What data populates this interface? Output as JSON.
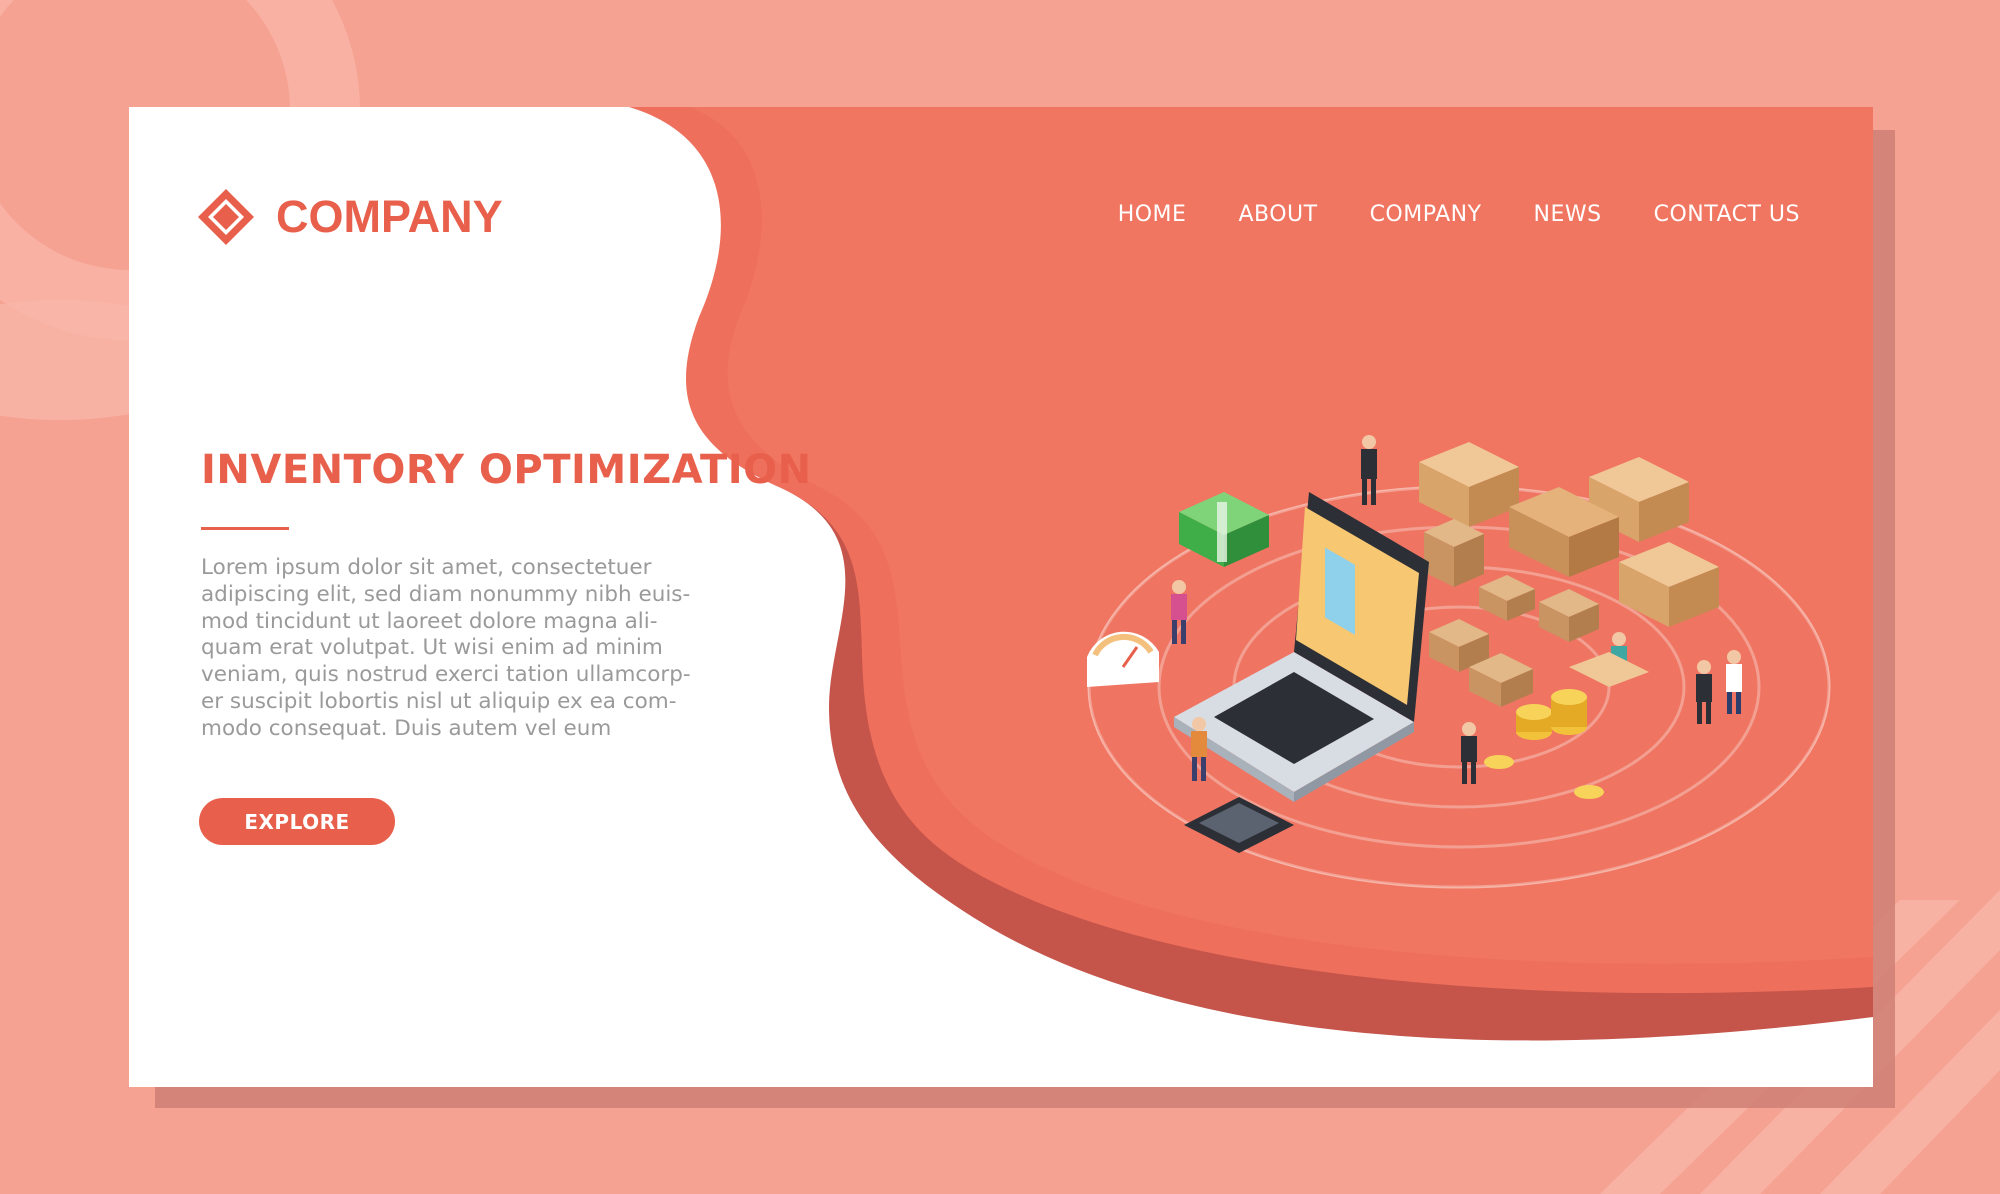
{
  "colors": {
    "background": "#f6a292",
    "accent": "#e8604c",
    "panel": "#ffffff",
    "body_text": "#9a9a9a",
    "nav_text": "#ffffff"
  },
  "logo": {
    "text": "COMPANY",
    "icon": "diamond-icon"
  },
  "nav": {
    "items": [
      {
        "label": "HOME"
      },
      {
        "label": "ABOUT"
      },
      {
        "label": "COMPANY"
      },
      {
        "label": "NEWS"
      },
      {
        "label": "CONTACT US"
      }
    ]
  },
  "hero": {
    "title": "INVENTORY OPTIMIZATION",
    "body_lines": [
      "Lorem ipsum dolor sit amet, consectetuer",
      "adipiscing elit, sed diam nonummy nibh euis-",
      "mod tincidunt ut laoreet dolore magna ali-",
      "quam erat volutpat. Ut wisi enim ad minim",
      "veniam, quis nostrud exerci tation ullamcorp-",
      "er suscipit lobortis nisl ut aliquip ex ea com-",
      "modo consequat. Duis autem vel eum"
    ],
    "cta_label": "EXPLORE"
  },
  "illustration": {
    "subject": "isometric inventory scene",
    "icons": [
      "laptop-icon",
      "cash-stack-icon",
      "gauge-icon",
      "calculator-icon",
      "coin-stack-icon",
      "box-icon",
      "pallet-icon",
      "person-icon"
    ]
  }
}
